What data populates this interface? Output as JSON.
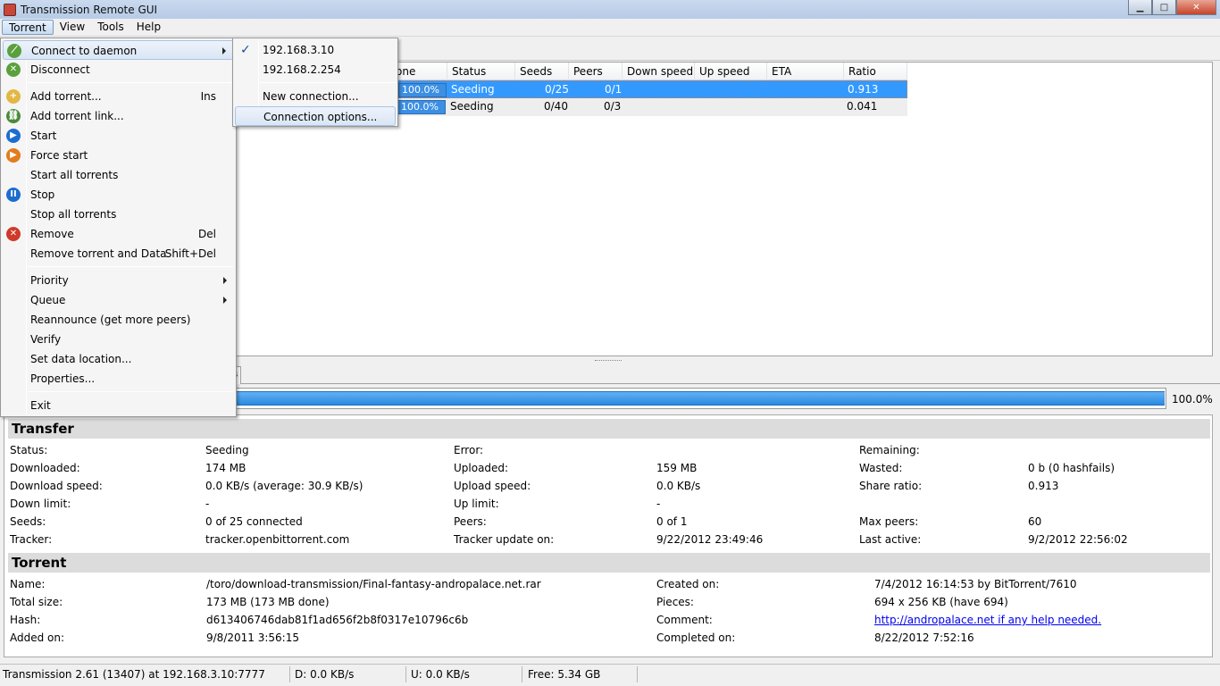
{
  "window": {
    "title": "Transmission Remote GUI",
    "minimize": "▁",
    "maximize": "□",
    "close": "✕"
  },
  "menubar": [
    "Torrent",
    "View",
    "Tools",
    "Help"
  ],
  "list": {
    "headers": [
      "one",
      "Status",
      "Seeds",
      "Peers",
      "Down speed",
      "Up speed",
      "ETA",
      "Ratio"
    ],
    "rows": [
      {
        "done": "100.0%",
        "status": "Seeding",
        "seeds": "0/25",
        "peers": "0/1",
        "ratio": "0.913"
      },
      {
        "done": "100.0%",
        "status": "Seeding",
        "seeds": "0/40",
        "peers": "0/3",
        "ratio": "0.041"
      }
    ]
  },
  "tab_stub": "s",
  "progress": {
    "value": 1.0,
    "label": "100.0%"
  },
  "transfer": {
    "title": "Transfer",
    "col1": [
      [
        "Status:",
        "Seeding"
      ],
      [
        "Downloaded:",
        "174 MB"
      ],
      [
        "Download speed:",
        "0.0 KB/s (average: 30.9 KB/s)"
      ],
      [
        "Down limit:",
        "-"
      ],
      [
        "Seeds:",
        "0 of 25 connected"
      ],
      [
        "Tracker:",
        "tracker.openbittorrent.com"
      ]
    ],
    "col2": [
      [
        "Error:",
        ""
      ],
      [
        "Uploaded:",
        "159 MB"
      ],
      [
        "Upload speed:",
        "0.0 KB/s"
      ],
      [
        "Up limit:",
        "-"
      ],
      [
        "Peers:",
        "0 of 1"
      ],
      [
        "Tracker update on:",
        "9/22/2012 23:49:46"
      ]
    ],
    "col3": [
      [
        "Remaining:",
        ""
      ],
      [
        "Wasted:",
        "0 b (0 hashfails)"
      ],
      [
        "Share ratio:",
        "0.913"
      ],
      [
        "",
        ""
      ],
      [
        "Max peers:",
        "60"
      ],
      [
        "Last active:",
        "9/2/2012 22:56:02"
      ]
    ]
  },
  "torrent": {
    "title": "Torrent",
    "col1": [
      [
        "Name:",
        "/toro/download-transmission/Final-fantasy-andropalace.net.rar"
      ],
      [
        "Total size:",
        "173 MB (173 MB done)"
      ],
      [
        "Hash:",
        "d613406746dab81f1ad656f2b8f0317e10796c6b"
      ],
      [
        "Added on:",
        "9/8/2011 3:56:15"
      ]
    ],
    "col2": [
      [
        "Created on:",
        "7/4/2012 16:14:53 by BitTorrent/7610"
      ],
      [
        "Pieces:",
        "694 x 256 KB (have 694)"
      ],
      [
        "Comment:",
        "http://andropalace.net if any help needed."
      ],
      [
        "Completed on:",
        "8/22/2012 7:52:16"
      ]
    ]
  },
  "statusbar": {
    "connection": "Transmission 2.61 (13407) at 192.168.3.10:7777",
    "down": "D: 0.0 KB/s",
    "up": "U: 0.0 KB/s",
    "free": "Free: 5.34 GB"
  },
  "torrent_menu": [
    {
      "label": "Connect to daemon",
      "submenu": true,
      "icon": "connect-icon"
    },
    {
      "label": "Disconnect",
      "icon": "disconnect-icon"
    },
    {
      "sep": true
    },
    {
      "label": "Add torrent...",
      "shortcut": "Ins",
      "icon": "folder-open-icon"
    },
    {
      "label": "Add torrent link...",
      "icon": "link-icon"
    },
    {
      "label": "Start",
      "icon": "play-icon"
    },
    {
      "label": "Force start",
      "icon": "force-start-icon"
    },
    {
      "label": "Start all torrents"
    },
    {
      "label": "Stop",
      "icon": "pause-icon"
    },
    {
      "label": "Stop all torrents"
    },
    {
      "label": "Remove",
      "shortcut": "Del",
      "icon": "remove-icon"
    },
    {
      "label": "Remove torrent and Data",
      "shortcut": "Shift+Del"
    },
    {
      "sep": true
    },
    {
      "label": "Priority",
      "submenu": true
    },
    {
      "label": "Queue",
      "submenu": true
    },
    {
      "label": "Reannounce (get more peers)"
    },
    {
      "label": "Verify"
    },
    {
      "label": "Set data location..."
    },
    {
      "label": "Properties..."
    },
    {
      "sep": true
    },
    {
      "label": "Exit"
    }
  ],
  "daemon_submenu": [
    {
      "label": "192.168.3.10",
      "checked": true
    },
    {
      "label": "192.168.2.254"
    },
    {
      "sep": true
    },
    {
      "label": "New connection..."
    },
    {
      "label": "Connection options...",
      "hover": true
    }
  ],
  "colors": {
    "accent": "#3399ff",
    "progress": "#2b8ae0",
    "link": "#0000ee"
  }
}
